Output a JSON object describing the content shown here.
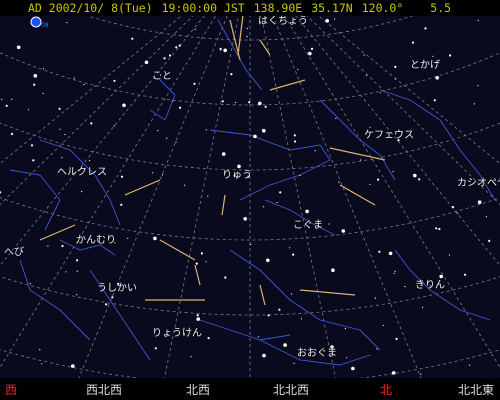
{
  "status": {
    "date": "AD 2002/10/ 8(Tue)",
    "time": "19:00:00 JST",
    "longitude": "138.90E",
    "latitude": "35.17N",
    "angle": "120.0°",
    "magnitude": "5.5",
    "icon": "moon-phase-icon"
  },
  "constellations": [
    {
      "name": "hakuchou",
      "label": "はくちょう"
    },
    {
      "name": "tokage",
      "label": "とかげ"
    },
    {
      "name": "koto",
      "label": "こと"
    },
    {
      "name": "kefeusu",
      "label": "ケフェウス"
    },
    {
      "name": "herukuresu",
      "label": "ヘルクレス"
    },
    {
      "name": "ryuu",
      "label": "りゅう"
    },
    {
      "name": "kashiopeia",
      "label": "カシオペヤ"
    },
    {
      "name": "kanmuri",
      "label": "かんむり"
    },
    {
      "name": "koguma",
      "label": "こぐま"
    },
    {
      "name": "hebi",
      "label": "へび"
    },
    {
      "name": "ushikai",
      "label": "うしかい"
    },
    {
      "name": "kirin",
      "label": "きりん"
    },
    {
      "name": "ryouken",
      "label": "りょうけん"
    },
    {
      "name": "ooguma",
      "label": "おおぐま"
    }
  ],
  "compass": [
    {
      "name": "west",
      "label": "西",
      "primary": true
    },
    {
      "name": "west-northwest",
      "label": "西北西",
      "primary": false
    },
    {
      "name": "northwest",
      "label": "北西",
      "primary": false
    },
    {
      "name": "north-northwest",
      "label": "北北西",
      "primary": false
    },
    {
      "name": "north",
      "label": "北",
      "primary": true
    },
    {
      "name": "north-northeast",
      "label": "北北東",
      "primary": false
    }
  ],
  "colors": {
    "sky": "#0a0a1e",
    "grid": "#7a7a90",
    "constellation_line": "#3a5ad0",
    "star": "#ffffff",
    "meteor": "#d9b46a",
    "status_text": "#c8c800",
    "primary_direction": "#ff2020"
  }
}
